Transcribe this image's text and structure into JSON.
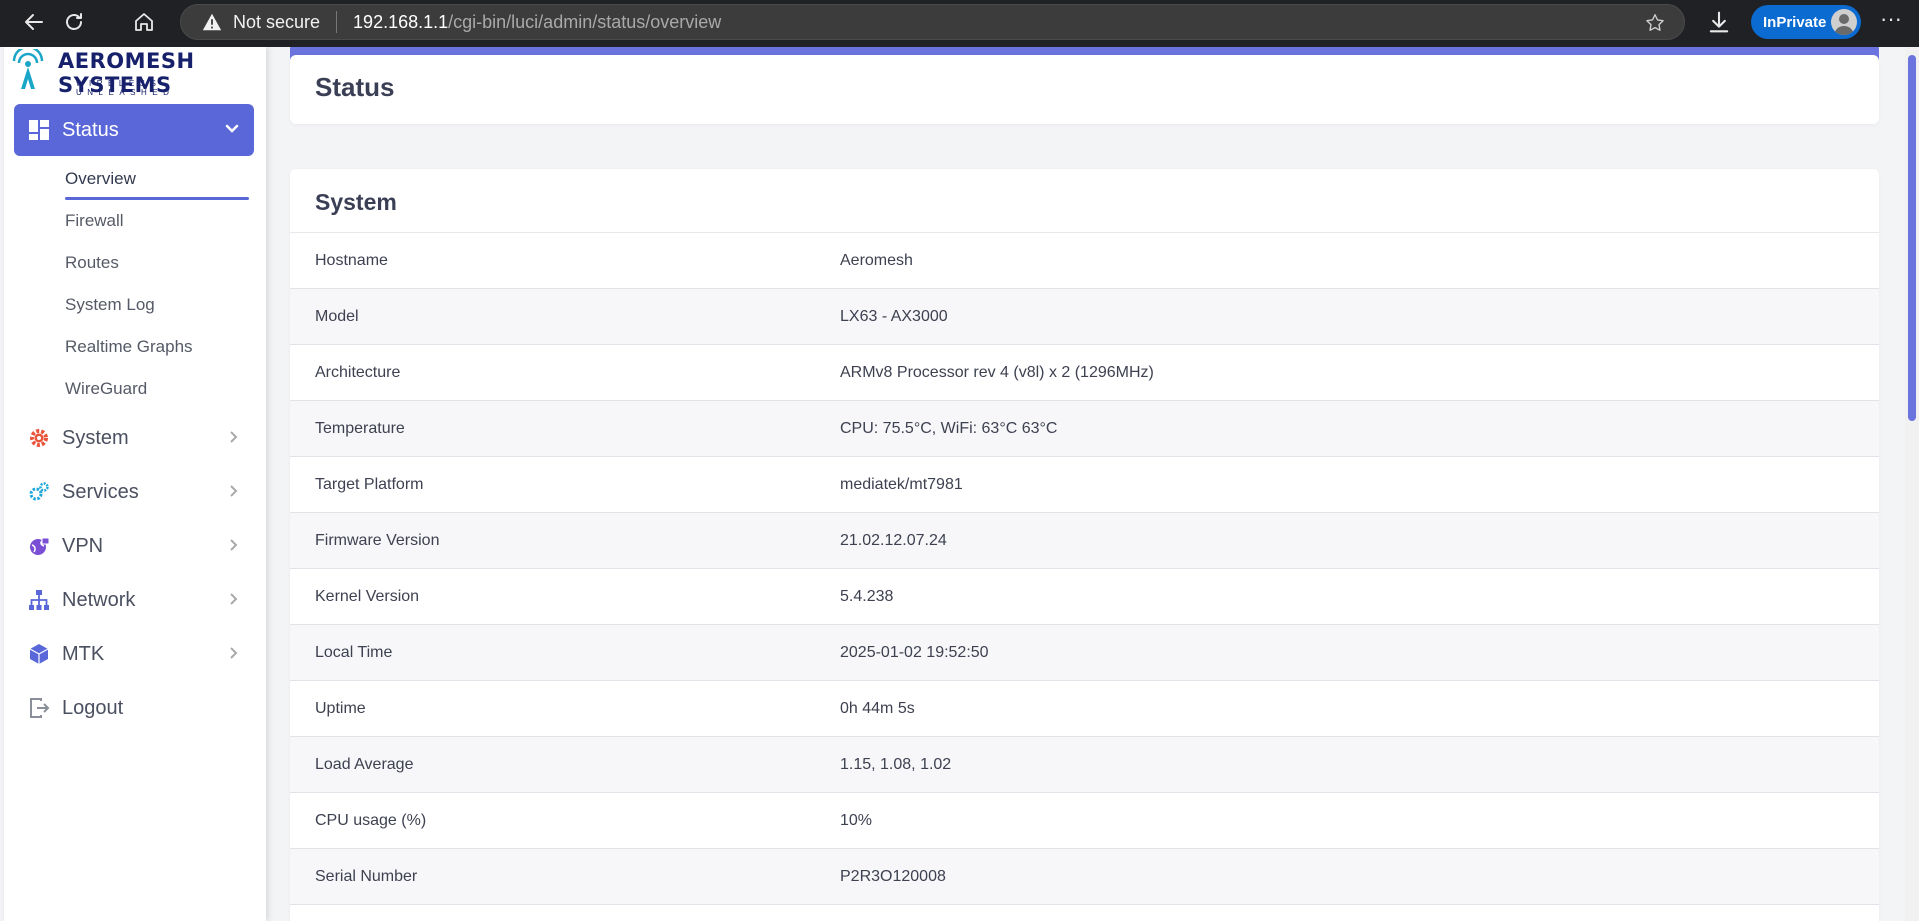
{
  "browser": {
    "not_secure": "Not secure",
    "url_host": "192.168.1.1",
    "url_path": "/cgi-bin/luci/admin/status/overview",
    "inprivate": "InPrivate",
    "more": "···"
  },
  "logo": {
    "title": "AEROMESH SYSTEMS",
    "tagline": "WIRELESS UNLEASHED"
  },
  "sidebar": {
    "status_label": "Status",
    "sub_items": [
      "Overview",
      "Firewall",
      "Routes",
      "System Log",
      "Realtime Graphs",
      "WireGuard"
    ],
    "items": [
      "System",
      "Services",
      "VPN",
      "Network",
      "MTK",
      "Logout"
    ]
  },
  "header": {
    "title": "Status"
  },
  "system": {
    "title": "System",
    "rows": [
      {
        "key": "Hostname",
        "value": "Aeromesh"
      },
      {
        "key": "Model",
        "value": "LX63 - AX3000"
      },
      {
        "key": "Architecture",
        "value": "ARMv8 Processor rev 4 (v8l) x 2 (1296MHz)"
      },
      {
        "key": "Temperature",
        "value": "CPU: 75.5°C, WiFi: 63°C 63°C"
      },
      {
        "key": "Target Platform",
        "value": "mediatek/mt7981"
      },
      {
        "key": "Firmware Version",
        "value": "21.02.12.07.24"
      },
      {
        "key": "Kernel Version",
        "value": "5.4.238"
      },
      {
        "key": "Local Time",
        "value": "2025-01-02 19:52:50"
      },
      {
        "key": "Uptime",
        "value": "0h 44m 5s"
      },
      {
        "key": "Load Average",
        "value": "1.15, 1.08, 1.02"
      },
      {
        "key": "CPU usage (%)",
        "value": "10%"
      },
      {
        "key": "Serial Number",
        "value": "P2R3O120008"
      }
    ]
  },
  "colors": {
    "accent": "#5a67d8",
    "system_icon": "#e8553a",
    "services_icon": "#1ea7d9",
    "vpn_icon": "#7a4fd6",
    "network_icon": "#5a67d8",
    "mtk_icon": "#5a67d8"
  }
}
